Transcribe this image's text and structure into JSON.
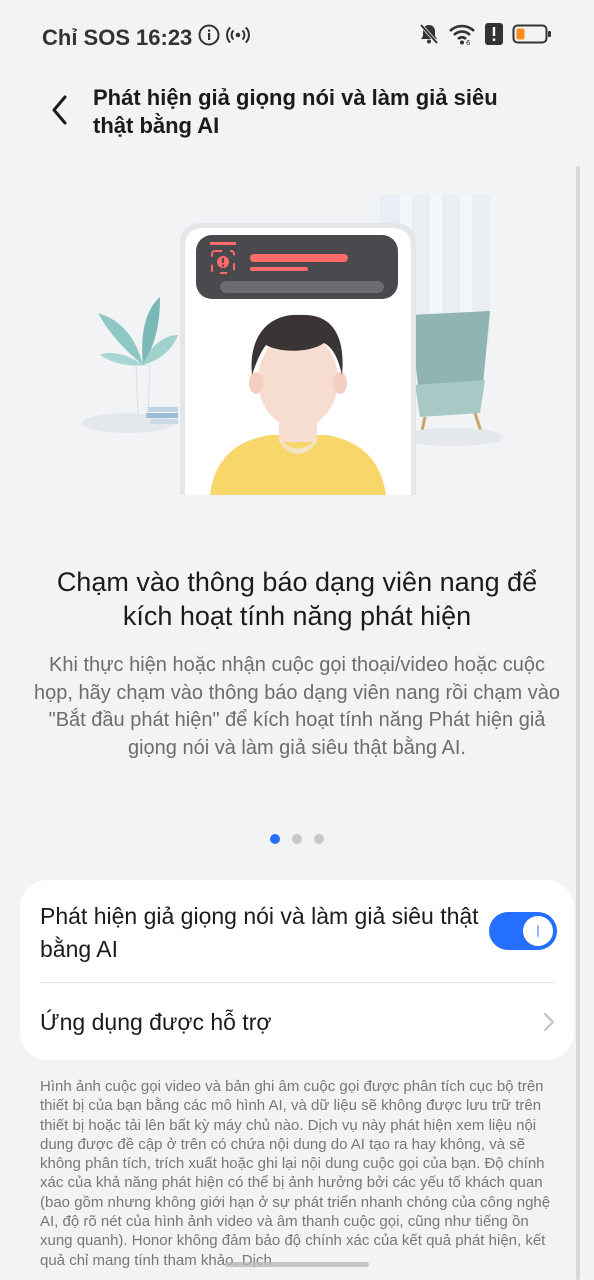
{
  "status_bar": {
    "carrier": "Chỉ SOS",
    "time": "16:23",
    "icons": [
      "info-icon",
      "hotspot-icon",
      "mute-bell-icon",
      "wifi-icon",
      "alert-icon",
      "battery-icon"
    ],
    "battery_color": "#ff8a1f"
  },
  "header": {
    "title": "Phát hiện giả giọng nói và làm giả siêu thật bằng AI"
  },
  "slide": {
    "heading": "Chạm vào thông báo dạng viên nang để kích hoạt tính năng phát hiện",
    "description": "Khi thực hiện hoặc nhận cuộc gọi thoại/video hoặc cuộc họp, hãy chạm vào thông báo dạng viên nang rồi chạm vào \"Bắt đầu phát hiện\" để kích hoạt tính năng Phát hiện giả giọng nói và làm giả siêu thật bằng AI.",
    "page_index": 1,
    "page_count": 3
  },
  "settings": {
    "toggle_label": "Phát hiện giả giọng nói và làm giả siêu thật bằng AI",
    "toggle_on": true,
    "apps_label": "Ứng dụng được hỗ trợ"
  },
  "disclaimer": "Hình ảnh cuộc gọi video và bản ghi âm cuộc gọi được phân tích cục bộ trên thiết bị của bạn bằng các mô hình AI, và dữ liệu sẽ không được lưu trữ trên thiết bị hoặc tải lên bất kỳ máy chủ nào. Dịch vụ này phát hiện xem liệu nội dung được đề cập ở trên có chứa nội dung do AI tạo ra hay không, và sẽ không phân tích, trích xuất hoặc ghi lại nội dung cuộc gọi của bạn. Độ chính xác của khả năng phát hiện có thể bị ảnh hưởng bởi các yếu tố khách quan (bao gồm nhưng không giới hạn ở sự phát triển nhanh chóng của công nghệ AI, độ rõ nét của hình ảnh video và âm thanh cuộc gọi, cũng như tiếng ồn xung quanh). Honor không đảm bảo độ chính xác của kết quả phát hiện, kết quả chỉ mang tính tham khảo. Dịch",
  "colors": {
    "accent": "#256fff",
    "background": "#f1f3f5",
    "card": "#ffffff"
  }
}
